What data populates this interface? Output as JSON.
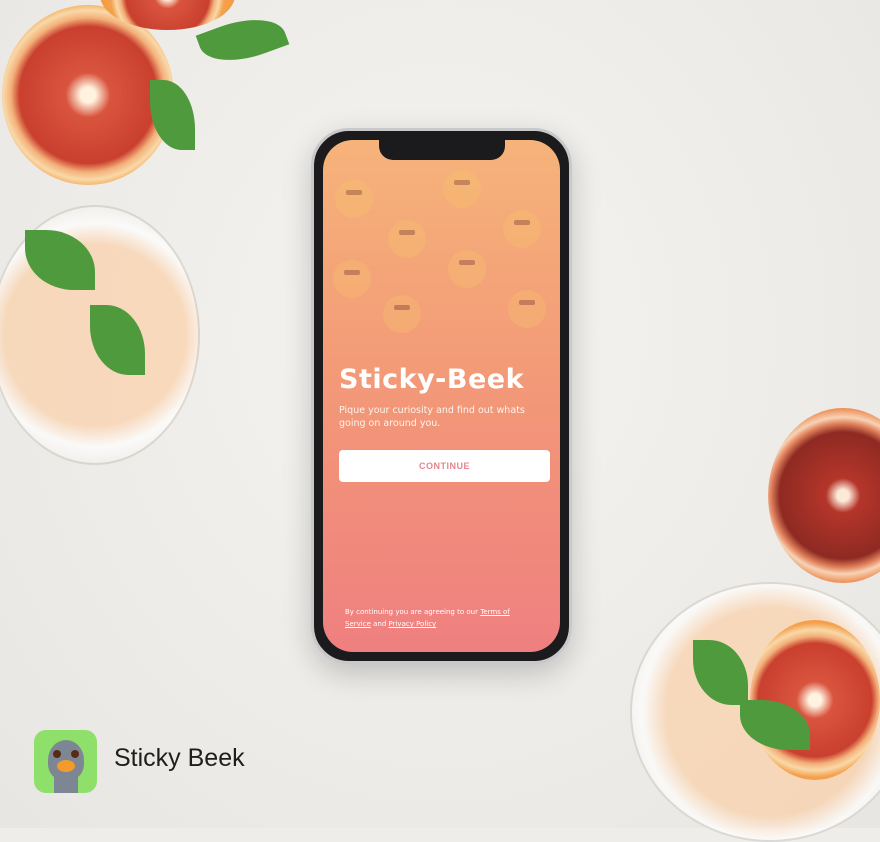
{
  "screen": {
    "app_title": "Sticky-Beek",
    "tagline": "Pique your curiosity and find out whats going on around you.",
    "continue_label": "CONTINUE",
    "legal_prefix": "By continuing you are agreeing to our ",
    "terms_link": "Terms of Service",
    "legal_and": " and ",
    "privacy_link": "Privacy Policy"
  },
  "footer": {
    "app_name": "Sticky Beek",
    "icon": "ostrich-app-icon"
  },
  "colors": {
    "gradient_top": "#f6b37a",
    "gradient_bottom": "#ef7f80",
    "button_text": "#e58590",
    "app_icon_bg": "#8ee06a"
  }
}
